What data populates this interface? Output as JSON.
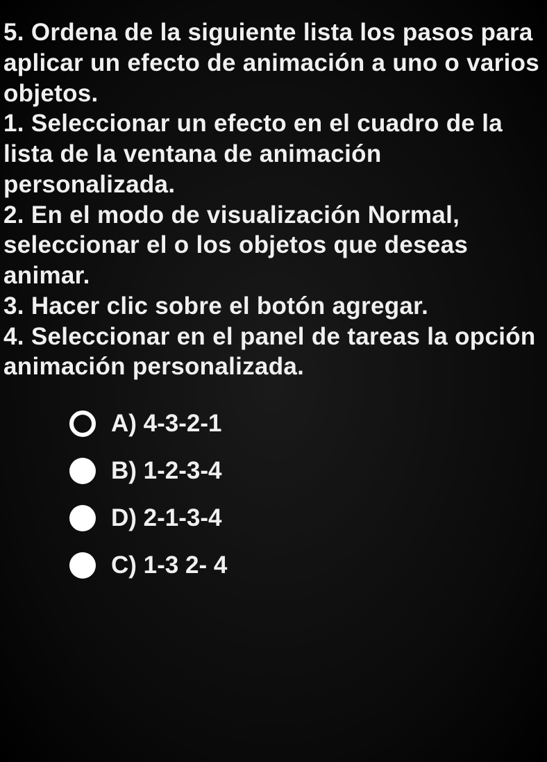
{
  "question": {
    "number": "5.",
    "prompt": "Ordena de la siguiente lista los pasos para aplicar un efecto de animación a uno o varios objetos.",
    "items": [
      "1. Seleccionar un efecto en el cuadro de la lista de la ventana de animación personalizada.",
      "2. En el modo de visualización Normal, seleccionar el o los objetos que deseas animar.",
      "3. Hacer clic sobre el botón agregar.",
      "4. Seleccionar en el panel de tareas la opción animación personalizada."
    ]
  },
  "options": [
    {
      "letter": "A)",
      "text": "4-3-2-1",
      "selected": true
    },
    {
      "letter": "B)",
      "text": "1-2-3-4",
      "selected": false
    },
    {
      "letter": "D)",
      "text": "2-1-3-4",
      "selected": false
    },
    {
      "letter": "C)",
      "text": "1-3 2- 4",
      "selected": false
    }
  ]
}
